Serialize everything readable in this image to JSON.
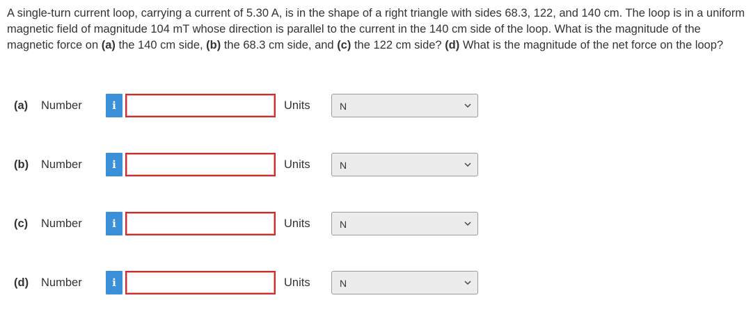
{
  "question": {
    "text_1": "A single-turn current loop, carrying a current of 5.30 A, is in the shape of a right triangle with sides 68.3, 122, and 140 cm. The loop is in a uniform magnetic field of magnitude 104 mT whose direction is parallel to the current in the 140 cm side of the loop. What is the magnitude of the magnetic force on ",
    "part_a_ref": "(a)",
    "text_2": " the 140 cm side, ",
    "part_b_ref": "(b)",
    "text_3": " the 68.3 cm side, and ",
    "part_c_ref": "(c)",
    "text_4": " the 122 cm side? ",
    "part_d_ref": "(d)",
    "text_5": " What is the magnitude of the net force on the loop?"
  },
  "parts": [
    {
      "label": "(a)",
      "number_label": "Number",
      "info_icon": "i",
      "value": "",
      "units_label": "Units",
      "unit": "N"
    },
    {
      "label": "(b)",
      "number_label": "Number",
      "info_icon": "i",
      "value": "",
      "units_label": "Units",
      "unit": "N"
    },
    {
      "label": "(c)",
      "number_label": "Number",
      "info_icon": "i",
      "value": "",
      "units_label": "Units",
      "unit": "N"
    },
    {
      "label": "(d)",
      "number_label": "Number",
      "info_icon": "i",
      "value": "",
      "units_label": "Units",
      "unit": "N"
    }
  ],
  "colors": {
    "info_button": "#3a8fd9",
    "input_error_border": "#c9302c",
    "select_background": "#ececec"
  }
}
